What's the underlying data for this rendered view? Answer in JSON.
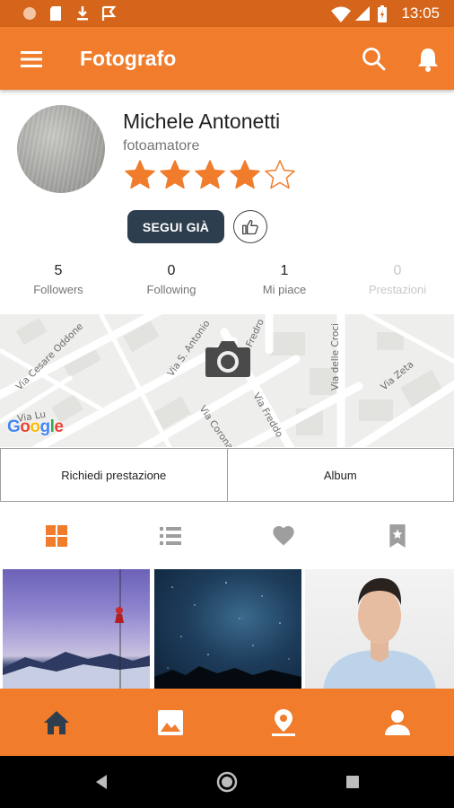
{
  "status_bar": {
    "time": "13:05",
    "left_icons": [
      "circle-notification-icon",
      "sd-card-icon",
      "download-icon",
      "flag-icon"
    ],
    "right_icons": [
      "wifi-icon",
      "signal-icon",
      "battery-icon"
    ]
  },
  "app_bar": {
    "title": "Fotografo",
    "icons": [
      "menu-icon",
      "search-icon",
      "bell-icon"
    ]
  },
  "profile": {
    "name": "Michele Antonetti",
    "role": "fotoamatore",
    "rating": 4,
    "rating_max": 5,
    "follow_label": "SEGUI GIÀ"
  },
  "stats": [
    {
      "value": "5",
      "label": "Followers",
      "enabled": true
    },
    {
      "value": "0",
      "label": "Following",
      "enabled": true
    },
    {
      "value": "1",
      "label": "Mi piace",
      "enabled": true
    },
    {
      "value": "0",
      "label": "Prestazioni",
      "enabled": false
    }
  ],
  "map": {
    "streets": [
      "Via Cesare Oddone",
      "Via S. Antonio",
      "Via Fredro",
      "Via delle Croci",
      "Via Zeta",
      "Via Corona",
      "Via Freddo",
      "Via Lu"
    ],
    "logo": [
      "G",
      "o",
      "o",
      "g",
      "l",
      "e"
    ]
  },
  "actions": {
    "request_label": "Richiedi prestazione",
    "album_label": "Album"
  },
  "view_tabs": [
    "grid-icon",
    "list-icon",
    "heart-icon",
    "bookmark-star-icon"
  ],
  "bottom_nav": [
    "home-icon",
    "image-icon",
    "location-pin-icon",
    "person-icon"
  ],
  "colors": {
    "primary": "#f07c2c",
    "status_bar": "#d5651a",
    "button_dark": "#2d3e4e",
    "star": "#f07c2c"
  }
}
